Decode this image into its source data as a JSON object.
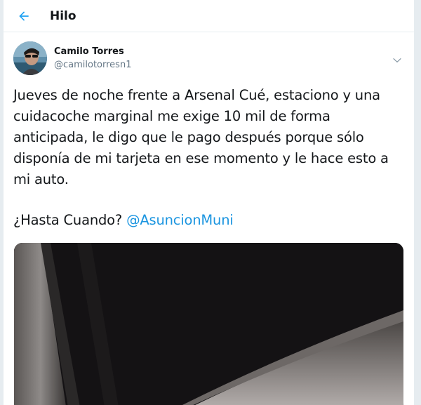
{
  "header": {
    "title": "Hilo"
  },
  "tweet": {
    "author": {
      "display_name": "Camilo Torres",
      "handle": "@camilotorresn1"
    },
    "body": {
      "paragraph1": "Jueves de noche frente a Arsenal Cué, estaciono y una cuidacoche marginal me exige 10 mil de forma anticipada, le digo que le pago después porque sólo disponía de mi tarjeta en ese momento y le hace esto a mi auto.",
      "paragraph2_text": "¿Hasta Cuando? ",
      "mention": "@AsuncionMuni"
    }
  },
  "colors": {
    "accent": "#1da1f2",
    "mention": "#1b95e0",
    "text": "#14171a",
    "secondary": "#657786"
  },
  "icons": {
    "back": "arrow-left-icon",
    "more": "chevron-down-icon"
  }
}
